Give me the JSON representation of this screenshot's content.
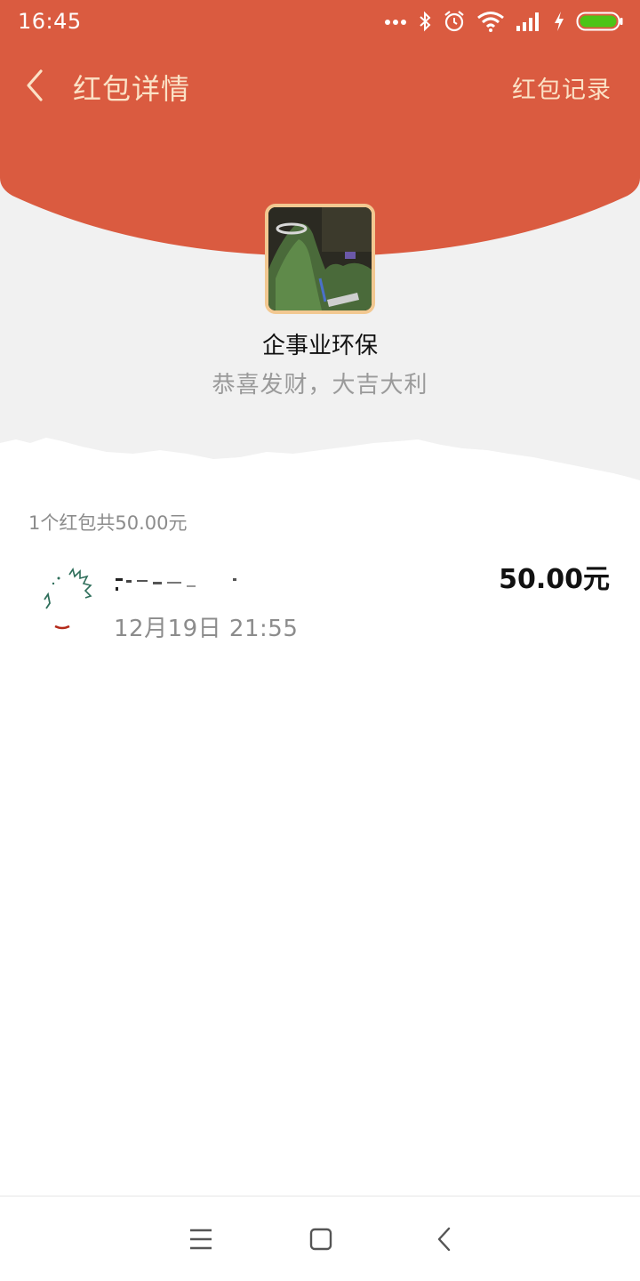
{
  "status_bar": {
    "time": "16:45",
    "icons": [
      "more-dots-icon",
      "bluetooth-icon",
      "alarm-icon",
      "wifi-icon",
      "signal-icon",
      "charging-icon",
      "battery-icon"
    ]
  },
  "header": {
    "title": "红包详情",
    "record_link": "红包记录",
    "color": "#da5b40",
    "text_color": "#fbe2c6"
  },
  "sender": {
    "name": "企事业环保",
    "greeting": "恭喜发财，大吉大利"
  },
  "summary": "1个红包共50.00元",
  "records": [
    {
      "time": "12月19日  21:55",
      "amount": "50.00元"
    }
  ],
  "system_nav": {
    "icons": [
      "menu-icon",
      "home-icon",
      "back-icon"
    ]
  }
}
